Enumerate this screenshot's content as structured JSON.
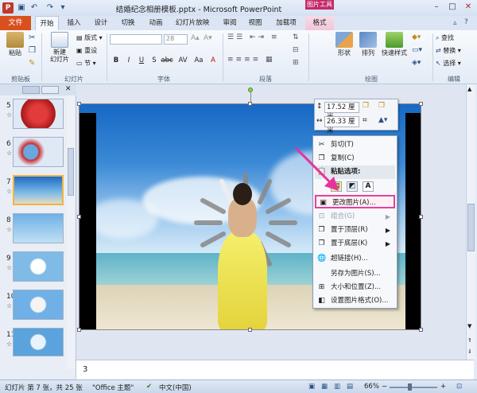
{
  "titlebar": {
    "app_icon_letter": "P",
    "title": "结婚纪念相册模板.pptx - Microsoft PowerPoint",
    "context_tab_group": "图片工具",
    "win_minimize": "–",
    "win_maximize": "□",
    "win_close": "✕"
  },
  "tabs": [
    "文件",
    "开始",
    "插入",
    "设计",
    "切换",
    "动画",
    "幻灯片放映",
    "审阅",
    "视图",
    "加载项",
    "格式"
  ],
  "ribbon": {
    "clipboard": {
      "paste": "粘贴",
      "group": "剪贴板"
    },
    "slides": {
      "new_slide": "新建\n幻灯片",
      "layout": "版式",
      "reset": "重设",
      "section": "节",
      "group": "幻灯片"
    },
    "font": {
      "size": "28",
      "group": "字体",
      "buttons": [
        "B",
        "I",
        "U",
        "S",
        "abc",
        "AV",
        "Aa",
        "A"
      ]
    },
    "paragraph": {
      "group": "段落"
    },
    "drawing": {
      "shape": "形状",
      "arrange": "排列",
      "quick_styles": "快速样式",
      "group": "绘图"
    },
    "editing": {
      "find": "查找",
      "replace": "替换",
      "select": "选择",
      "group": "编辑"
    }
  },
  "slides_panel": {
    "items": [
      {
        "num": "5",
        "star": "☆"
      },
      {
        "num": "6",
        "star": "☆"
      },
      {
        "num": "7",
        "star": "☆"
      },
      {
        "num": "8",
        "star": "☆"
      },
      {
        "num": "9",
        "star": "☆"
      },
      {
        "num": "10",
        "star": "☆"
      },
      {
        "num": "11",
        "star": "☆"
      }
    ],
    "selected_num": "7"
  },
  "mini_toolbar": {
    "height": "17.52 厘米",
    "width": "26.33 厘米"
  },
  "context_menu": {
    "cut": "剪切(T)",
    "copy": "复制(C)",
    "paste_options": "粘贴选项:",
    "change_picture": "更改图片(A)...",
    "group": "组合(G)",
    "bring_front": "置于顶层(R)",
    "send_back": "置于底层(K)",
    "hyperlink": "超链接(H)...",
    "save_as_picture": "另存为图片(S)...",
    "size_position": "大小和位置(Z)...",
    "format_picture": "设置图片格式(O)..."
  },
  "notes": {
    "text": "3"
  },
  "statusbar": {
    "slide_info": "幻灯片 第 7 张，共 25 张",
    "theme": "\"Office 主题\"",
    "language": "中文(中国)",
    "zoom": "66%"
  },
  "colors": {
    "file_tab": "#d9501f",
    "picture_tools": "#c42b6a",
    "selection_highlight": "#e0449c"
  }
}
